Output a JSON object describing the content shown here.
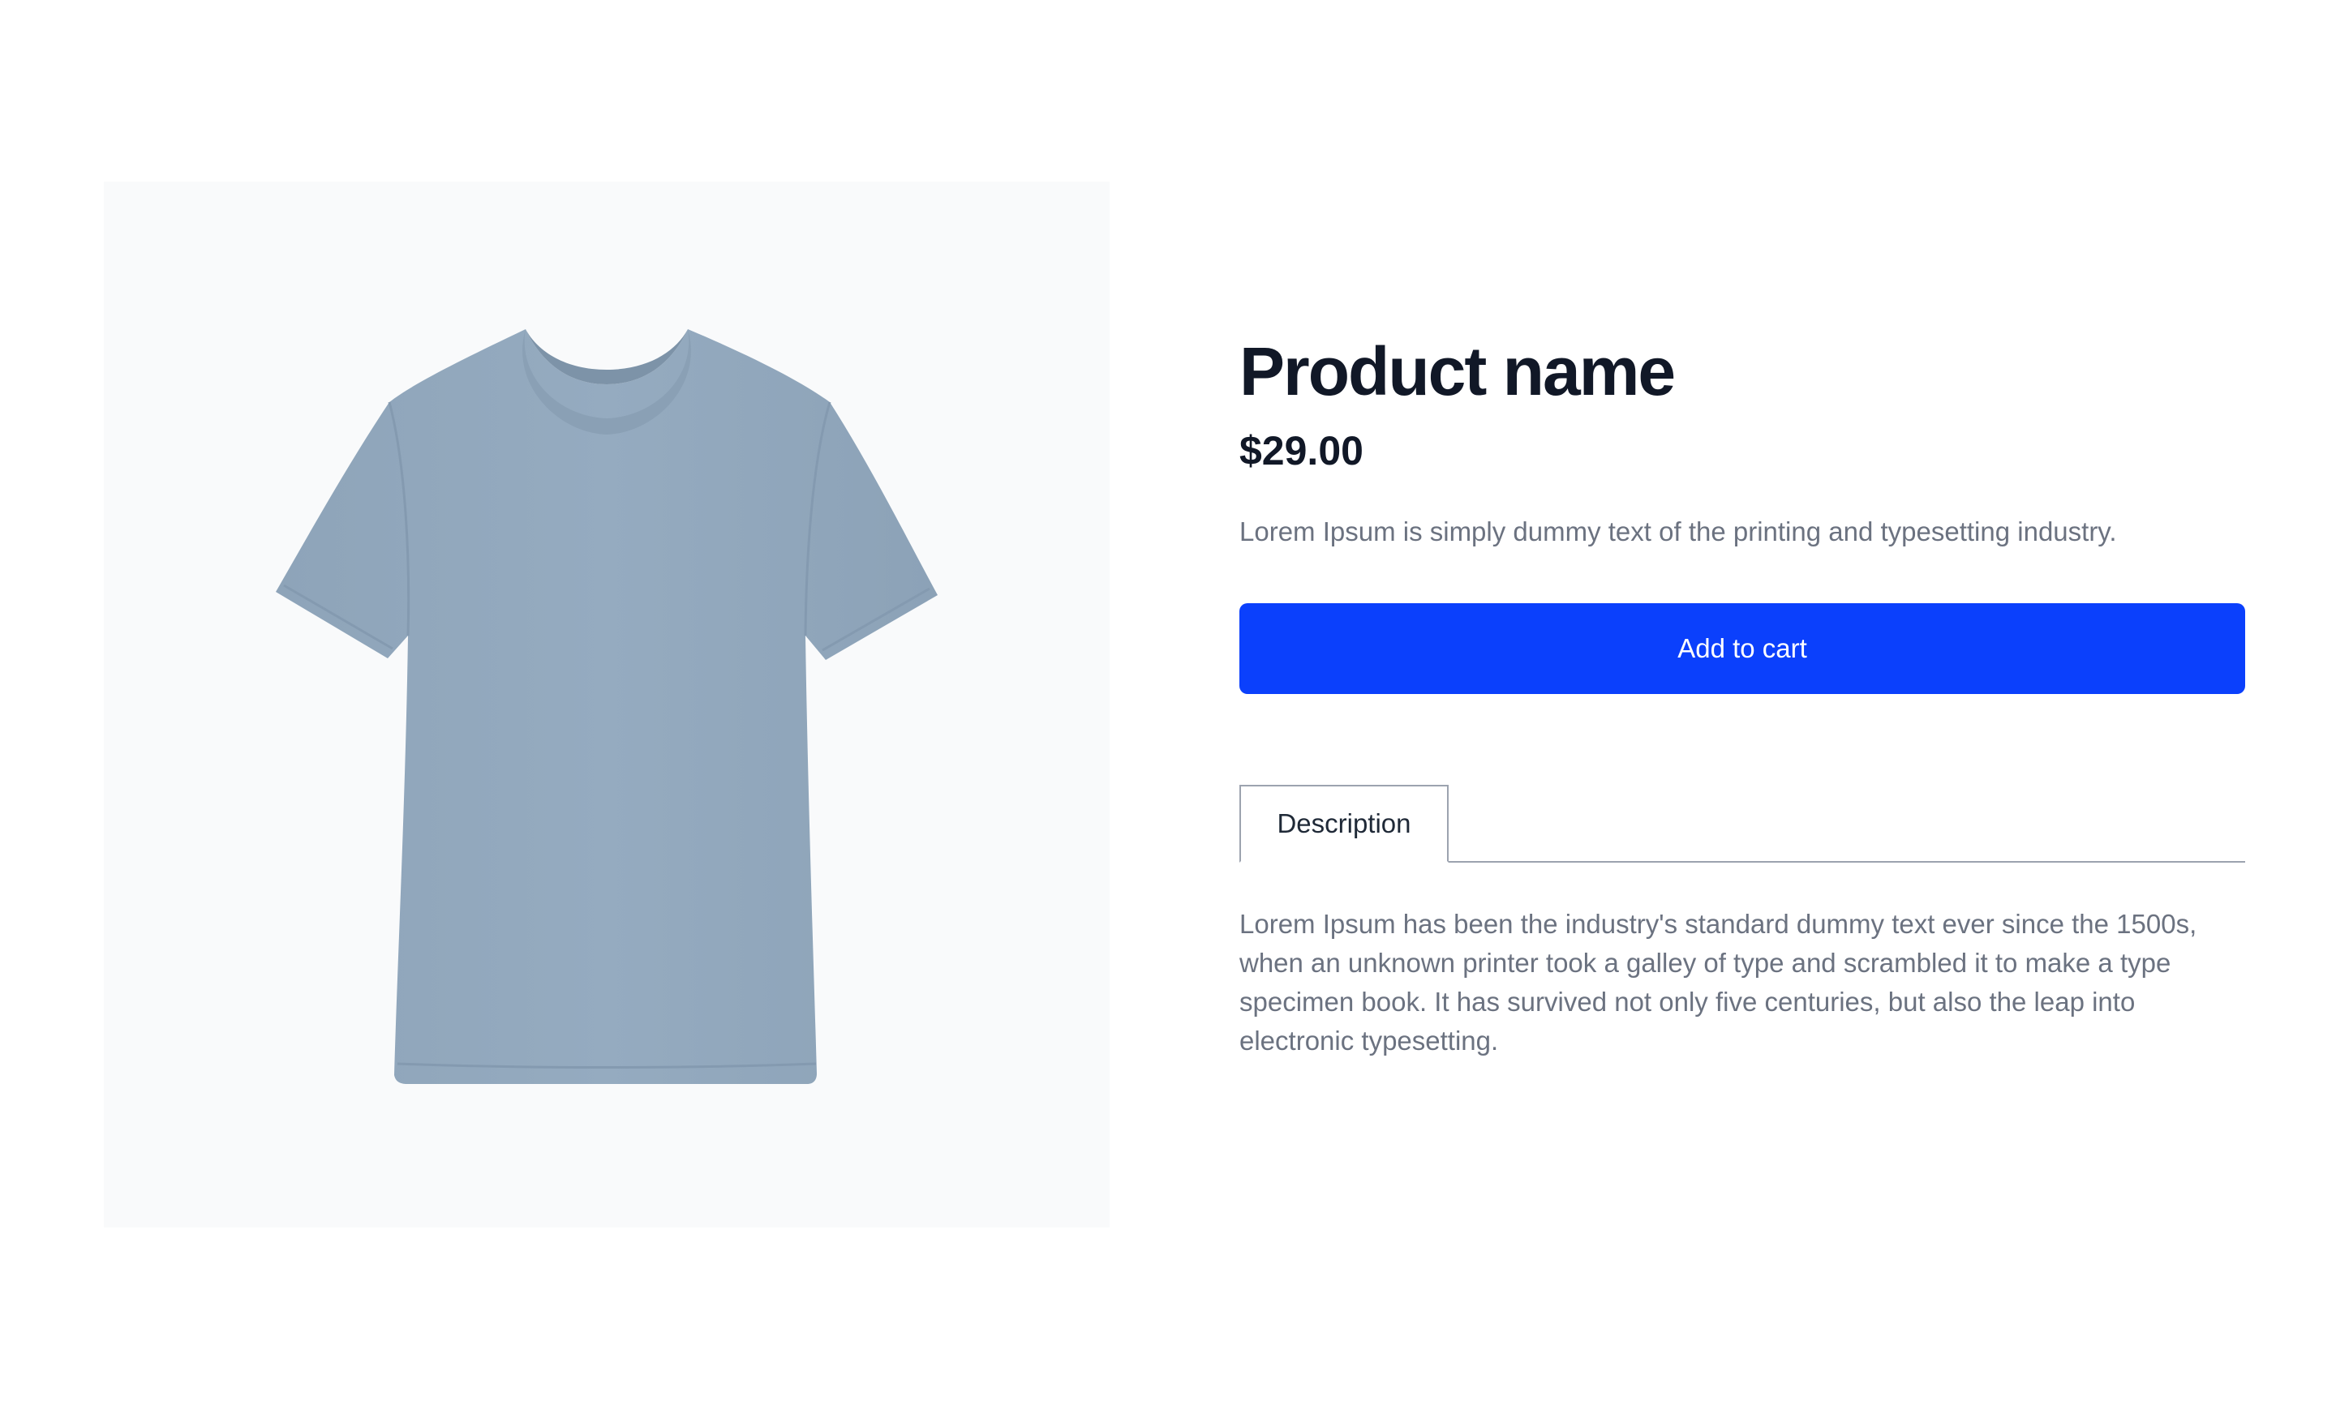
{
  "product": {
    "name": "Product name",
    "price": "$29.00",
    "short_description": "Lorem Ipsum is simply dummy text of the printing and typesetting industry.",
    "image_icon": "t-shirt-image",
    "image_color": "#93a9bd"
  },
  "actions": {
    "add_to_cart_label": "Add to cart",
    "accent_color": "#0b40fc"
  },
  "tabs": [
    {
      "label": "Description",
      "active": true
    }
  ],
  "description": {
    "text": "Lorem Ipsum has been the industry's standard dummy text ever since the 1500s, when an unknown printer took a galley of type and scrambled it to make a type specimen book. It has survived not only five centuries, but also the leap into electronic typesetting."
  }
}
